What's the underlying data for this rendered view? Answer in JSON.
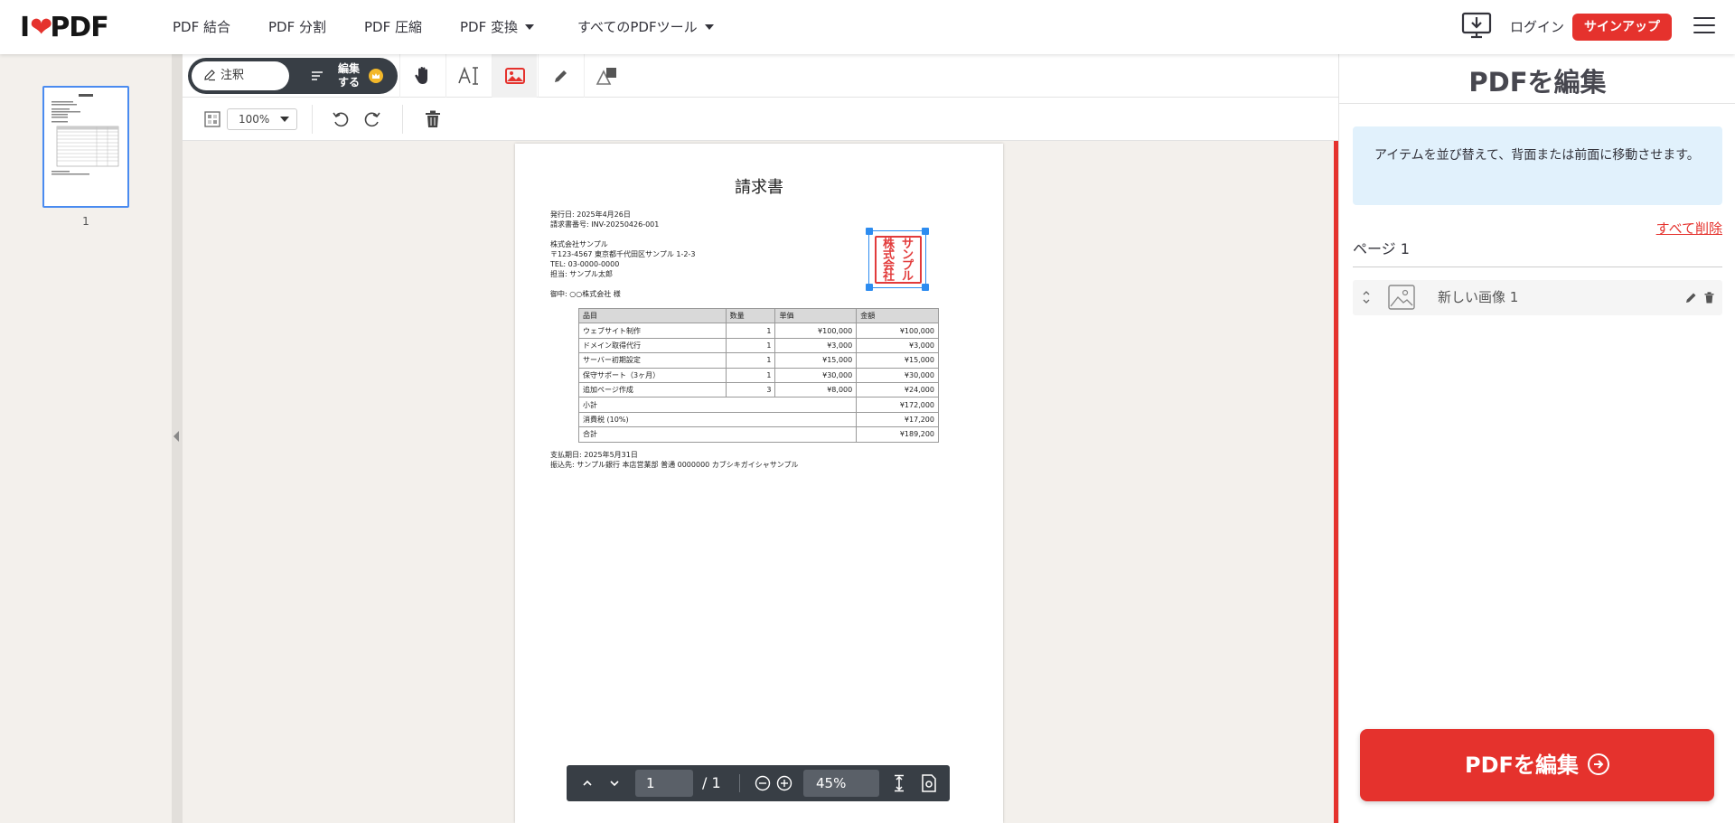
{
  "header": {
    "logo_left": "I",
    "logo_right": "PDF",
    "nav": [
      "PDF 結合",
      "PDF 分割",
      "PDF 圧縮",
      "PDF 変換",
      "すべてのPDFツール"
    ],
    "login": "ログイン",
    "signup": "サインアップ"
  },
  "thumbnails": {
    "page_number": "1"
  },
  "toolbar": {
    "annotate_label": "注釈",
    "edit_label_line1": "編集",
    "edit_label_line2": "する",
    "zoom_select": "100%"
  },
  "document": {
    "title": "請求書",
    "meta": [
      "発行日: 2025年4月26日",
      "請求書番号: INV-20250426-001"
    ],
    "issuer": [
      "株式会社サンプル",
      "〒123-4567 東京都千代田区サンプル 1-2-3",
      "TEL: 03-0000-0000",
      "担当: サンプル太郎"
    ],
    "recipient": "御中: ○○株式会社 様",
    "stamp_text": "株式会社サンプル",
    "stamp_col1": [
      "株",
      "式",
      "会",
      "社"
    ],
    "stamp_col2": [
      "サ",
      "ン",
      "プ",
      "ル"
    ],
    "table": {
      "headers": [
        "品目",
        "数量",
        "単価",
        "金額"
      ],
      "rows": [
        [
          "ウェブサイト制作",
          "1",
          "¥100,000",
          "¥100,000"
        ],
        [
          "ドメイン取得代行",
          "1",
          "¥3,000",
          "¥3,000"
        ],
        [
          "サーバー初期設定",
          "1",
          "¥15,000",
          "¥15,000"
        ],
        [
          "保守サポート（3ヶ月）",
          "1",
          "¥30,000",
          "¥30,000"
        ],
        [
          "追加ページ作成",
          "3",
          "¥8,000",
          "¥24,000"
        ]
      ],
      "summary": [
        [
          "小計",
          "¥172,000"
        ],
        [
          "消費税 (10%)",
          "¥17,200"
        ],
        [
          "合計",
          "¥189,200"
        ]
      ]
    },
    "footer": [
      "支払期日: 2025年5月31日",
      "振込先: サンプル銀行 本店営業部 普通 0000000 カブシキガイシャサンプル"
    ]
  },
  "pager": {
    "current_page": "1",
    "total": "/ 1",
    "zoom": "45%"
  },
  "right_panel": {
    "title": "PDFを編集",
    "info": "アイテムを並び替えて、背面または前面に移動させます。",
    "clear_all": "すべて削除",
    "page_label": "ページ 1",
    "layer_name": "新しい画像 1",
    "cta": "PDFを編集"
  },
  "colors": {
    "brand_red": "#e5322d",
    "dark_toolbar": "#383e45",
    "info_bg": "#e1f1fc",
    "selection_blue": "#2d8cf0"
  }
}
